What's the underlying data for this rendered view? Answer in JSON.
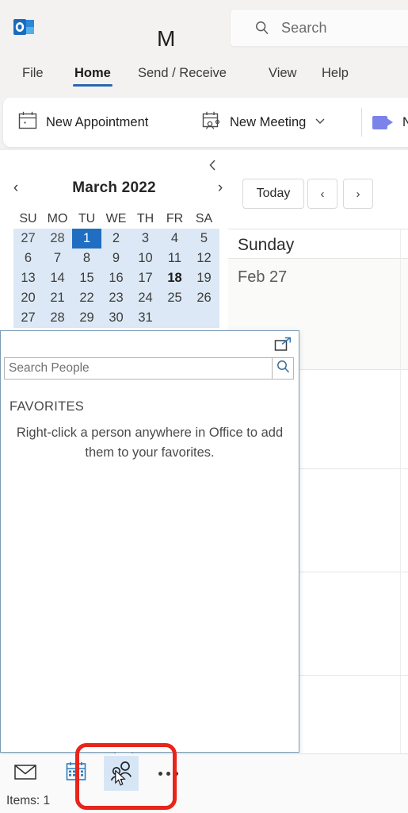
{
  "window": {
    "app_icon": "outlook-logo-icon"
  },
  "search": {
    "placeholder": "Search",
    "icon": "search-icon"
  },
  "tabs": [
    {
      "id": "file",
      "label": "File",
      "selected": false
    },
    {
      "id": "home",
      "label": "Home",
      "selected": true
    },
    {
      "id": "send",
      "label": "Send / Receive",
      "selected": false
    },
    {
      "id": "view",
      "label": "View",
      "selected": false
    },
    {
      "id": "help",
      "label": "Help",
      "selected": false
    }
  ],
  "ribbon": {
    "new_appointment": {
      "label": "New Appointment",
      "icon": "calendar-new-icon"
    },
    "new_meeting": {
      "label": "New Meeting",
      "icon": "calendar-people-icon",
      "chevron": "˅"
    },
    "teams_meeting": {
      "label": "N",
      "icon": "teams-camera-icon"
    }
  },
  "mini_calendar": {
    "collapse_icon": "chevron-left-icon",
    "prev_icon": "‹",
    "next_icon": "›",
    "title": "March 2022",
    "day_headers": [
      "SU",
      "MO",
      "TU",
      "WE",
      "TH",
      "FR",
      "SA"
    ],
    "weeks": [
      [
        {
          "d": "27",
          "state": "other"
        },
        {
          "d": "28",
          "state": "other"
        },
        {
          "d": "1",
          "state": "selected"
        },
        {
          "d": "2",
          "state": "normal"
        },
        {
          "d": "3",
          "state": "normal"
        },
        {
          "d": "4",
          "state": "normal"
        },
        {
          "d": "5",
          "state": "normal"
        }
      ],
      [
        {
          "d": "6",
          "state": "normal"
        },
        {
          "d": "7",
          "state": "normal"
        },
        {
          "d": "8",
          "state": "normal"
        },
        {
          "d": "9",
          "state": "normal"
        },
        {
          "d": "10",
          "state": "normal"
        },
        {
          "d": "11",
          "state": "normal"
        },
        {
          "d": "12",
          "state": "normal"
        }
      ],
      [
        {
          "d": "13",
          "state": "normal"
        },
        {
          "d": "14",
          "state": "normal"
        },
        {
          "d": "15",
          "state": "normal"
        },
        {
          "d": "16",
          "state": "normal"
        },
        {
          "d": "17",
          "state": "normal"
        },
        {
          "d": "18",
          "state": "today"
        },
        {
          "d": "19",
          "state": "normal"
        }
      ],
      [
        {
          "d": "20",
          "state": "normal"
        },
        {
          "d": "21",
          "state": "normal"
        },
        {
          "d": "22",
          "state": "normal"
        },
        {
          "d": "23",
          "state": "normal"
        },
        {
          "d": "24",
          "state": "normal"
        },
        {
          "d": "25",
          "state": "normal"
        },
        {
          "d": "26",
          "state": "normal"
        }
      ],
      [
        {
          "d": "27",
          "state": "normal"
        },
        {
          "d": "28",
          "state": "normal"
        },
        {
          "d": "29",
          "state": "normal"
        },
        {
          "d": "30",
          "state": "normal"
        },
        {
          "d": "31",
          "state": "normal"
        },
        {
          "d": "",
          "state": "normal"
        },
        {
          "d": "",
          "state": "normal"
        }
      ]
    ]
  },
  "calendar_toolbar": {
    "today_label": "Today",
    "prev_label": "‹",
    "next_label": "›",
    "month_heading": "M"
  },
  "calendar_grid": {
    "day_name": "Sunday",
    "date_label": "Feb 27"
  },
  "people_peek": {
    "popout_icon": "pop-out-icon",
    "search_placeholder": "Search People",
    "search_icon": "search-icon",
    "section_label": "FAVORITES",
    "empty_message": "Right-click a person anywhere in Office to add them to your favorites."
  },
  "module_bar": {
    "items": [
      {
        "id": "mail",
        "icon": "mail-icon",
        "active": false
      },
      {
        "id": "calendar",
        "icon": "calendar-icon",
        "active": false
      },
      {
        "id": "people",
        "icon": "people-icon",
        "active": true
      },
      {
        "id": "more",
        "icon": "ellipsis-icon",
        "active": false
      }
    ]
  },
  "status_bar": {
    "items_label": "Items: 1"
  },
  "annotation": {
    "highlight_color": "#e8241b",
    "target": "people-module-button"
  }
}
